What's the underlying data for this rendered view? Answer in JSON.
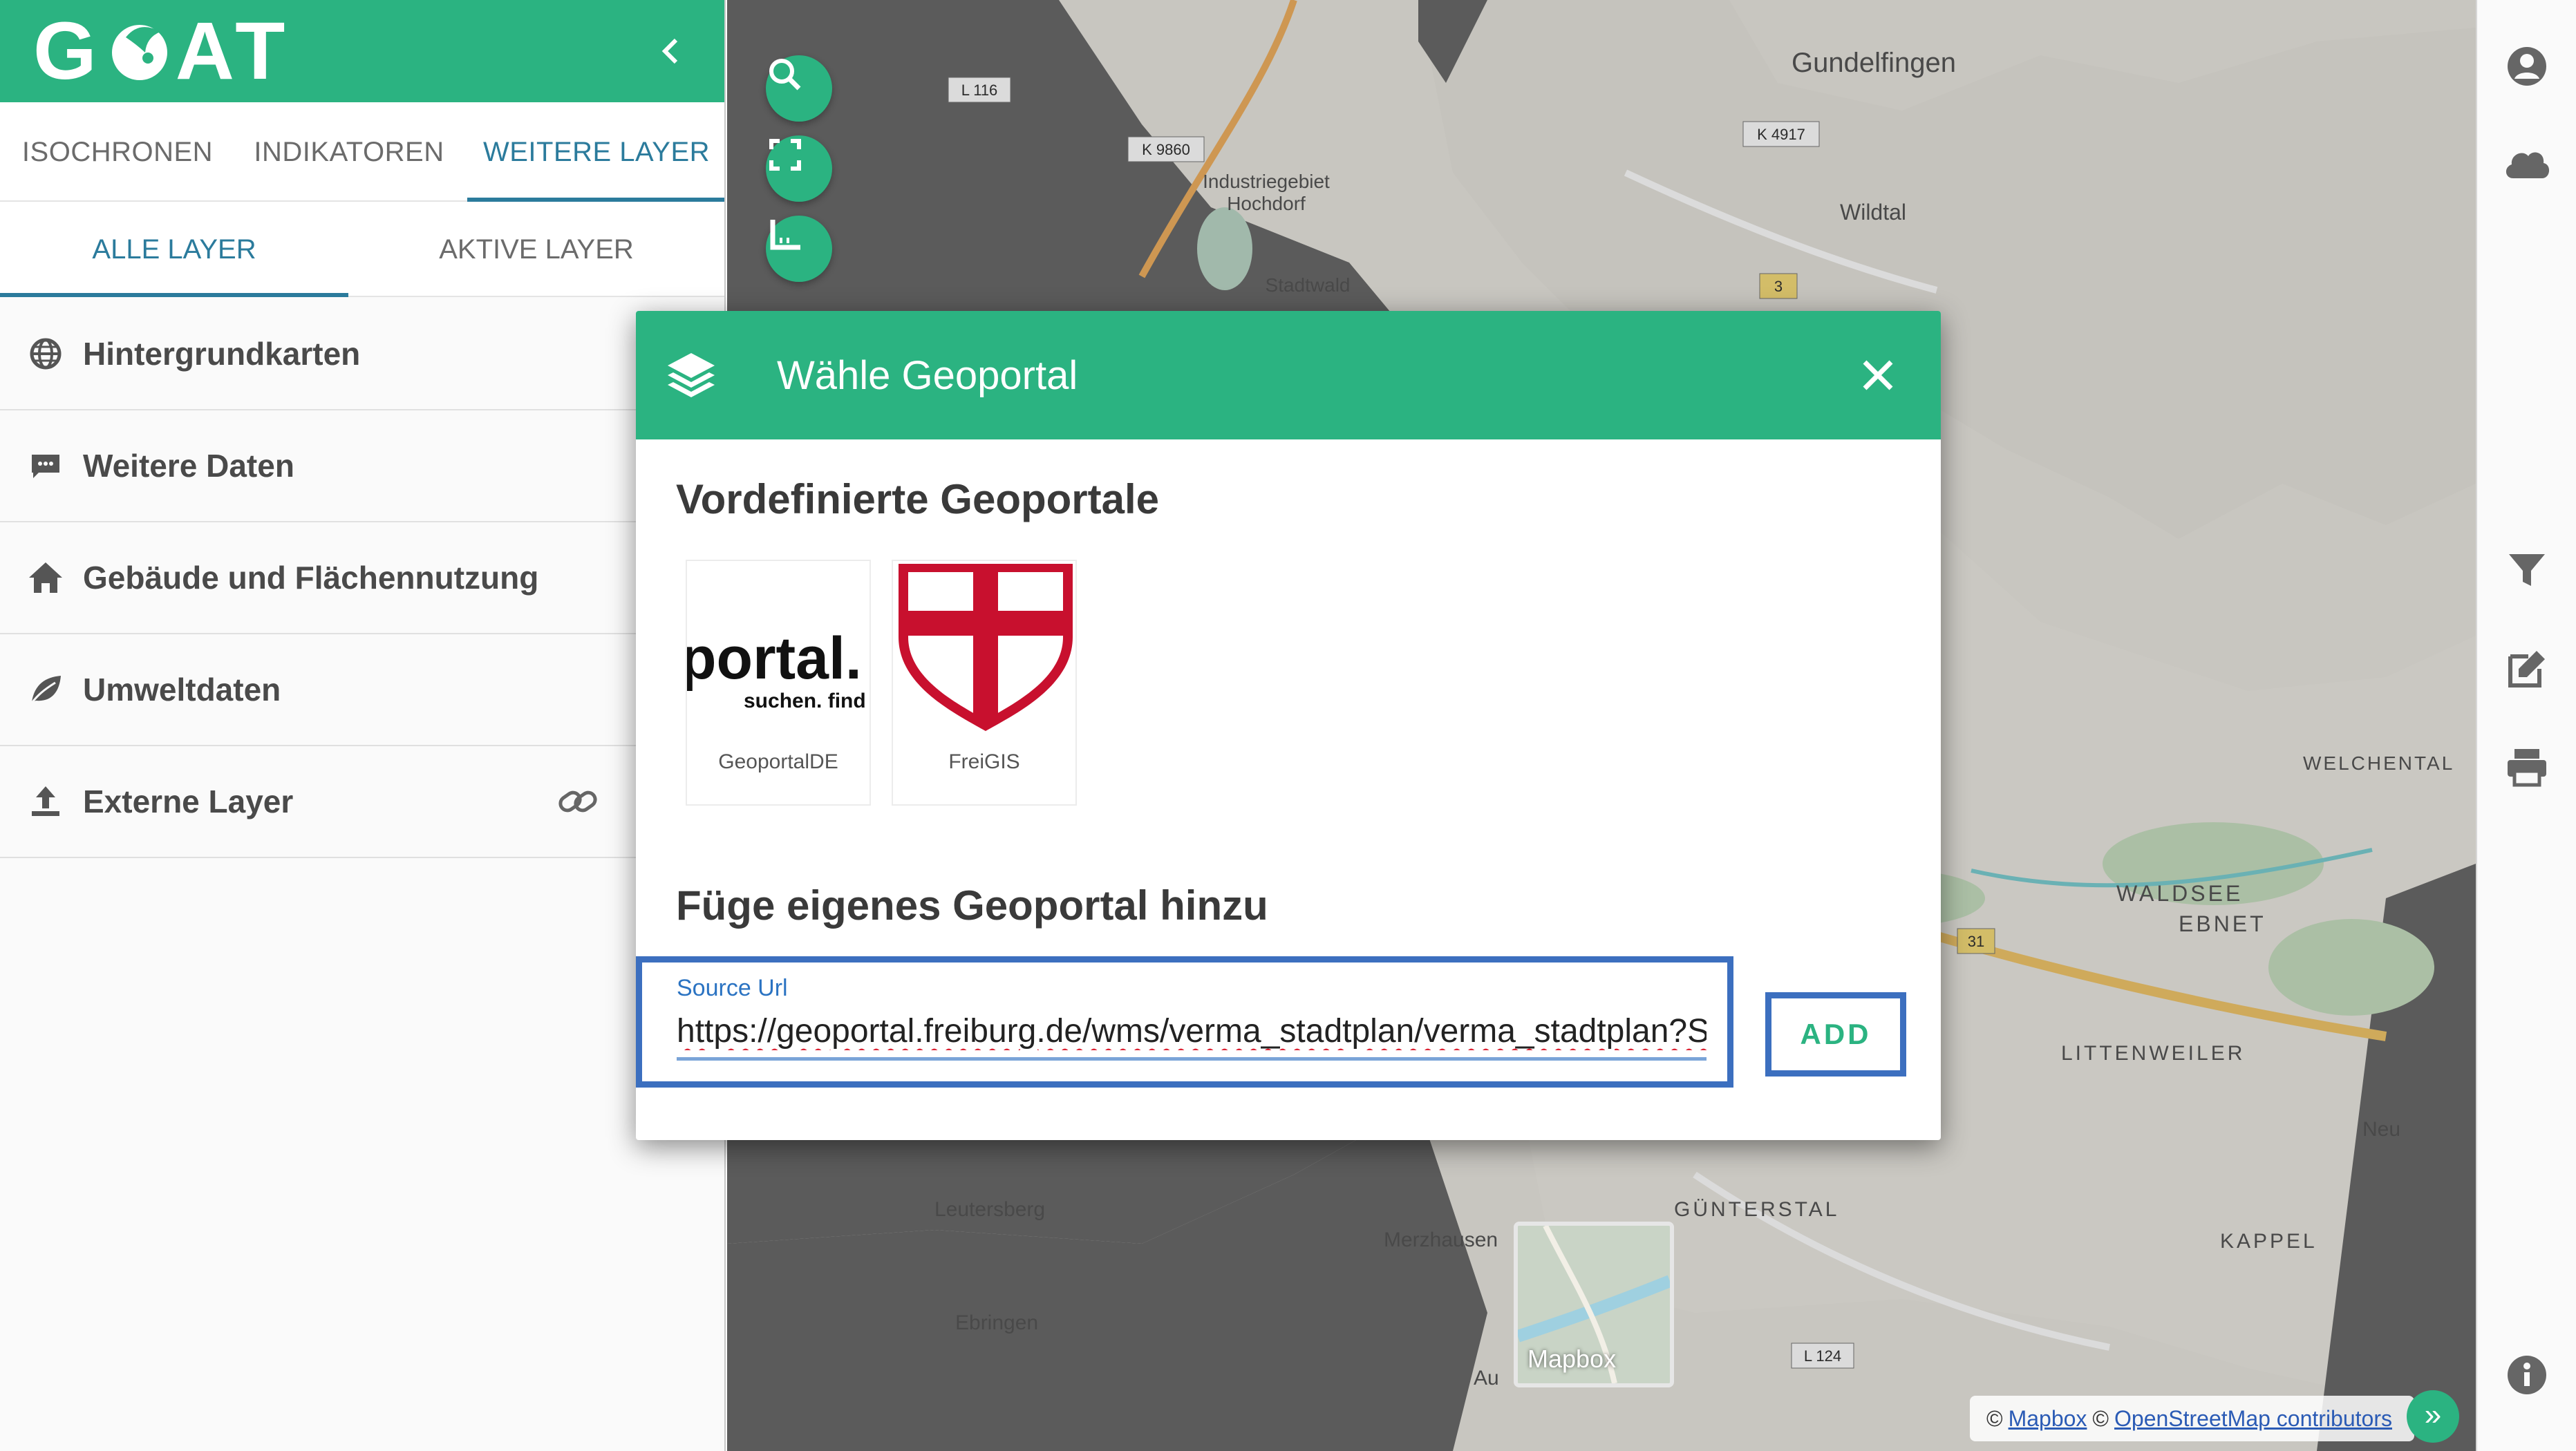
{
  "app": {
    "logo": "GOAT",
    "collapse_icon": "chevron-left-icon"
  },
  "main_tabs": [
    {
      "label": "ISOCHRONEN",
      "active": false
    },
    {
      "label": "INDIKATOREN",
      "active": false
    },
    {
      "label": "WEITERE LAYER",
      "active": true
    }
  ],
  "sub_tabs": [
    {
      "label": "ALLE LAYER",
      "active": true
    },
    {
      "label": "AKTIVE LAYER",
      "active": false
    }
  ],
  "layer_groups": [
    {
      "label": "Hintergrundkarten",
      "icon": "globe-icon"
    },
    {
      "label": "Weitere Daten",
      "icon": "comment-icon"
    },
    {
      "label": "Gebäude und Flächennutzung",
      "icon": "home-icon"
    },
    {
      "label": "Umweltdaten",
      "icon": "leaf-icon"
    },
    {
      "label": "Externe Layer",
      "icon": "upload-icon",
      "action_icon": "link-icon"
    }
  ],
  "map": {
    "place_labels": [
      "Gundelfingen",
      "Industriegebiet Hochdorf",
      "Stadtwald",
      "Wildtal",
      "WELCHENTAL",
      "WALDSEE",
      "EBNET",
      "LITTENWEILER",
      "GÜNTERSTAL",
      "KAPPEL",
      "Merzhausen",
      "Leutersberg",
      "Ebringen",
      "Au",
      "Neu"
    ],
    "road_labels": [
      "K 9860",
      "K 4917",
      "L 116",
      "L 124",
      "31",
      "3"
    ],
    "basemap_switch_label": "Mapbox",
    "attribution": {
      "prefix": "©",
      "mapbox": "Mapbox",
      "separator": "©",
      "osm": "OpenStreetMap contributors"
    },
    "attribution_toggle": "»",
    "control_icons": [
      "search-icon",
      "fullscreen-icon",
      "measure-icon"
    ]
  },
  "right_toolbar": [
    "account-icon",
    "cloud-icon",
    "filter-icon",
    "edit-icon",
    "print-icon",
    "info-icon"
  ],
  "dialog": {
    "title": "Wähle Geoportal",
    "predefined_heading": "Vordefinierte Geoportale",
    "portals": [
      {
        "name": "GeoportalDE",
        "logo_text": "portal.",
        "logo_subtext": "suchen. find"
      },
      {
        "name": "FreiGIS"
      }
    ],
    "custom_heading": "Füge eigenes Geoportal hinzu",
    "url_label": "Source Url",
    "url_value": "https://geoportal.freiburg.de/wms/verma_stadtplan/verma_stadtplan?S",
    "add_label": "ADD"
  },
  "colors": {
    "brand_green": "#2bb381",
    "tab_active": "#2b7b9c",
    "highlight_border": "#3c6fbf"
  }
}
